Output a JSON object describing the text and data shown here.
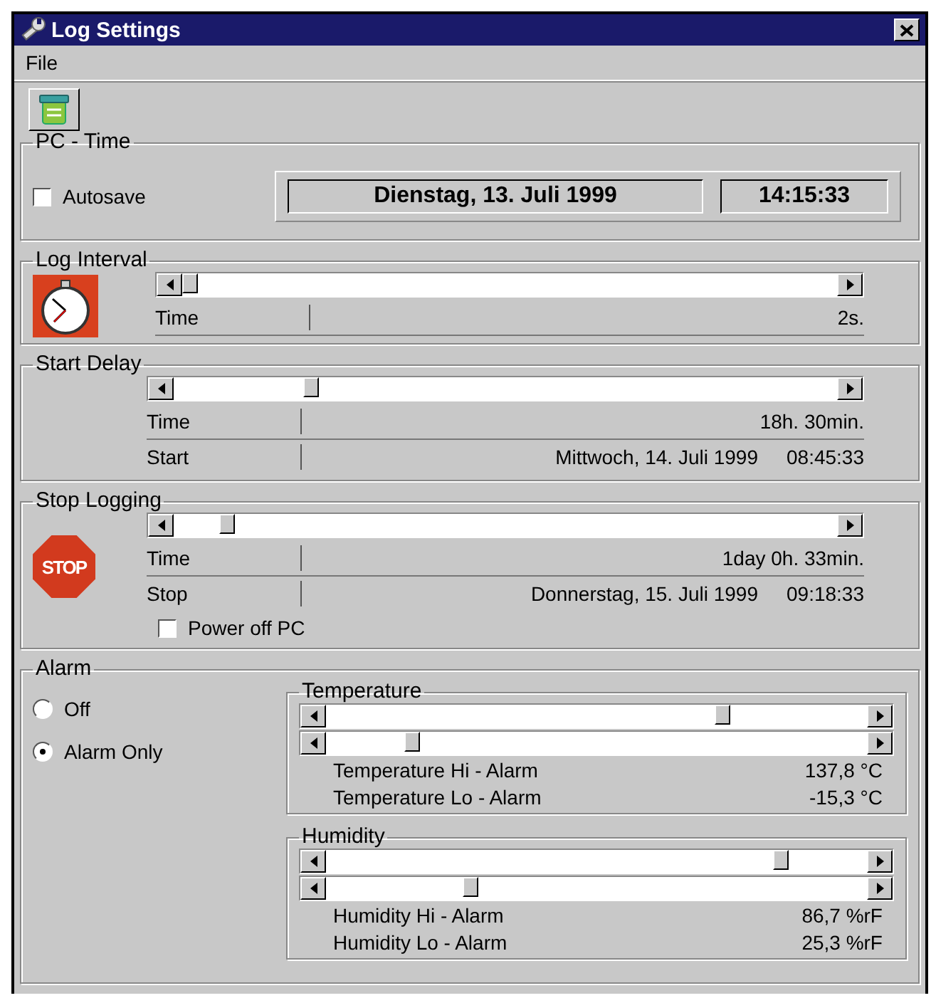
{
  "window": {
    "title": "Log Settings"
  },
  "menu": [
    {
      "label": "File"
    }
  ],
  "pc_time": {
    "title": "PC - Time",
    "autosave": {
      "label": "Autosave",
      "checked": false
    },
    "date": "Dienstag, 13. Juli 1999",
    "time": "14:15:33"
  },
  "log_interval": {
    "title": "Log Interval",
    "rows": [
      {
        "label": "Time",
        "values": [
          "2s."
        ]
      }
    ]
  },
  "start_delay": {
    "title": "Start Delay",
    "rows": [
      {
        "label": "Time",
        "values": [
          "18h. 30min."
        ]
      },
      {
        "label": "Start",
        "values": [
          "Mittwoch, 14. Juli 1999",
          "08:45:33"
        ]
      }
    ]
  },
  "stop_logging": {
    "title": "Stop Logging",
    "sign": "STOP",
    "rows": [
      {
        "label": "Time",
        "values": [
          "1day 0h. 33min."
        ]
      },
      {
        "label": "Stop",
        "values": [
          "Donnerstag, 15. Juli 1999",
          "09:18:33"
        ]
      }
    ],
    "power_off": {
      "label": "Power off PC",
      "checked": false
    }
  },
  "alarm": {
    "title": "Alarm",
    "modes": [
      {
        "label": "Off",
        "selected": false
      },
      {
        "label": "Alarm Only",
        "selected": true
      }
    ],
    "groups": [
      {
        "title": "Temperature",
        "readings": [
          {
            "label": "Temperature Hi - Alarm",
            "value": "137,8 °C"
          },
          {
            "label": "Temperature Lo - Alarm",
            "value": "-15,3 °C"
          }
        ]
      },
      {
        "title": "Humidity",
        "readings": [
          {
            "label": "Humidity Hi - Alarm",
            "value": "86,7 %rF"
          },
          {
            "label": "Humidity Lo - Alarm",
            "value": "25,3 %rF"
          }
        ]
      }
    ]
  }
}
